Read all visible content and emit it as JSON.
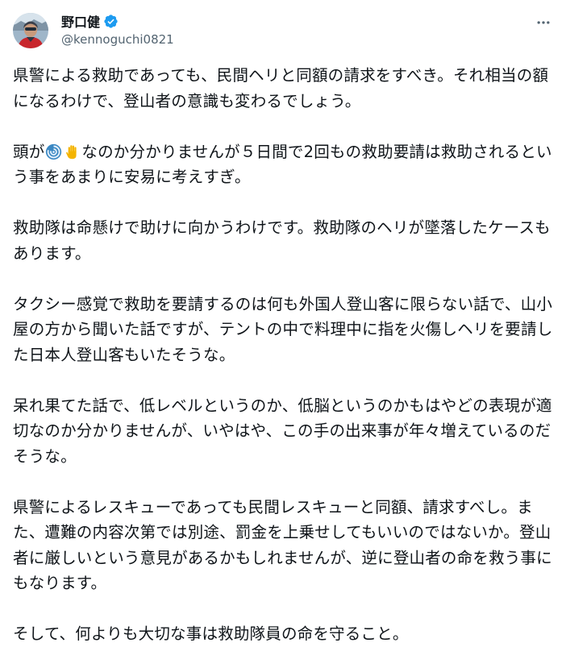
{
  "author": {
    "display_name": "野口健",
    "handle": "@kennoguchi0821",
    "verified_color": "#1d9bf0"
  },
  "menu": {
    "icon": "more-horizontal-icon"
  },
  "tweet": {
    "p1": "県警による救助であっても、民間ヘリと同額の請求をすべき。それ相当の額になるわけで、登山者の意識も変わるでしょう。",
    "p2_before": "頭が",
    "p2_emoji_1": "cyclone-emoji",
    "p2_emoji_2": "raised-hand-emoji",
    "p2_after": "なのか分かりませんが５日間で2回もの救助要請は救助されるという事をあまりに安易に考えすぎ。",
    "p3": "救助隊は命懸けで助けに向かうわけです。救助隊のヘリが墜落したケースもあります。",
    "p4": "タクシー感覚で救助を要請するのは何も外国人登山客に限らない話で、山小屋の方から聞いた話ですが、テントの中で料理中に指を火傷しヘリを要請した日本人登山客もいたそうな。",
    "p5": "呆れ果てた話で、低レベルというのか、低脳というのかもはやどの表現が適切なのか分かりませんが、いやはや、この手の出来事が年々増えているのだそうな。",
    "p6": "県警によるレスキューであっても民間レスキューと同額、請求すべし。また、遭難の内容次第では別途、罰金を上乗せしてもいいのではないか。登山者に厳しいという意見があるかもしれませんが、逆に登山者の命を救う事にもなります。",
    "p7": "そして、何よりも大切な事は救助隊員の命を守ること。"
  }
}
